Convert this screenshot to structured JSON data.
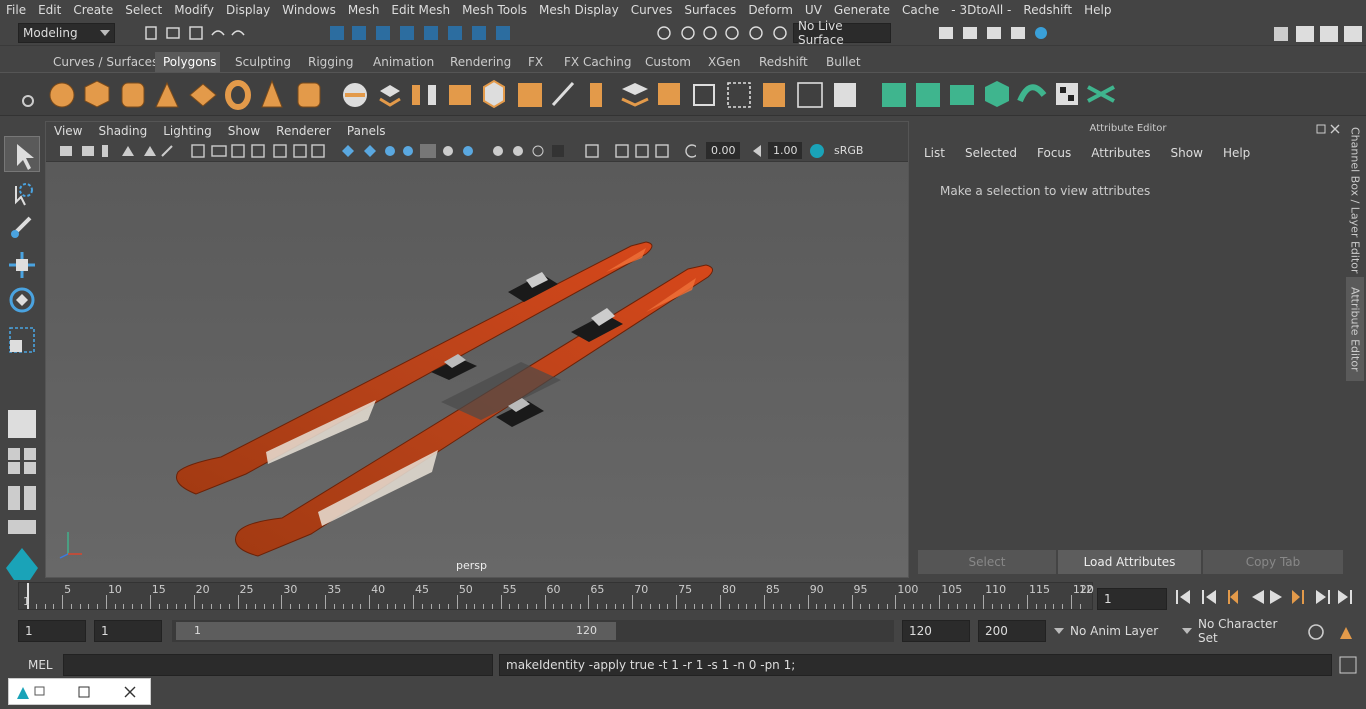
{
  "menubar": [
    "File",
    "Edit",
    "Create",
    "Select",
    "Modify",
    "Display",
    "Windows",
    "Mesh",
    "Edit Mesh",
    "Mesh Tools",
    "Mesh Display",
    "Curves",
    "Surfaces",
    "Deform",
    "UV",
    "Generate",
    "Cache",
    "- 3DtoAll -",
    "Redshift",
    "Help"
  ],
  "status": {
    "mode": "Modeling",
    "live_surface": "No Live Surface"
  },
  "shelf_tabs": [
    "Curves / Surfaces",
    "Polygons",
    "Sculpting",
    "Rigging",
    "Animation",
    "Rendering",
    "FX",
    "FX Caching",
    "Custom",
    "XGen",
    "Redshift",
    "Bullet"
  ],
  "shelf_active": "Polygons",
  "viewport": {
    "menu": [
      "View",
      "Shading",
      "Lighting",
      "Show",
      "Renderer",
      "Panels"
    ],
    "exposure": "0.00",
    "gamma": "1.00",
    "color_space": "sRGB gamma",
    "camera": "persp"
  },
  "attribute_editor": {
    "title": "Attribute Editor",
    "menu": [
      "List",
      "Selected",
      "Focus",
      "Attributes",
      "Show",
      "Help"
    ],
    "message": "Make a selection to view attributes",
    "buttons": [
      "Select",
      "Load Attributes",
      "Copy Tab"
    ]
  },
  "side_tabs": [
    "Channel Box / Layer Editor",
    "Attribute Editor"
  ],
  "timeline": {
    "ticks": [
      5,
      10,
      15,
      20,
      25,
      30,
      35,
      40,
      45,
      50,
      55,
      60,
      65,
      70,
      75,
      80,
      85,
      90,
      95,
      100,
      105,
      110,
      115,
      120
    ],
    "start_label": "1",
    "end_label": "12",
    "current_frame": "1"
  },
  "range": {
    "start": "1",
    "playback_start": "1",
    "slider_start": "1",
    "slider_end": "120",
    "playback_end": "120",
    "end": "200",
    "anim_layer": "No Anim Layer",
    "character_set": "No Character Set"
  },
  "command": {
    "lang": "MEL",
    "input": "",
    "result": "makeIdentity -apply true -t 1 -r 1 -s 1 -n 0 -pn 1;"
  },
  "colors": {
    "accent": "#5285a6",
    "shelf_orange": "#e39a4a",
    "shelf_green": "#3fb58e",
    "ski_red": "#c8421a"
  }
}
